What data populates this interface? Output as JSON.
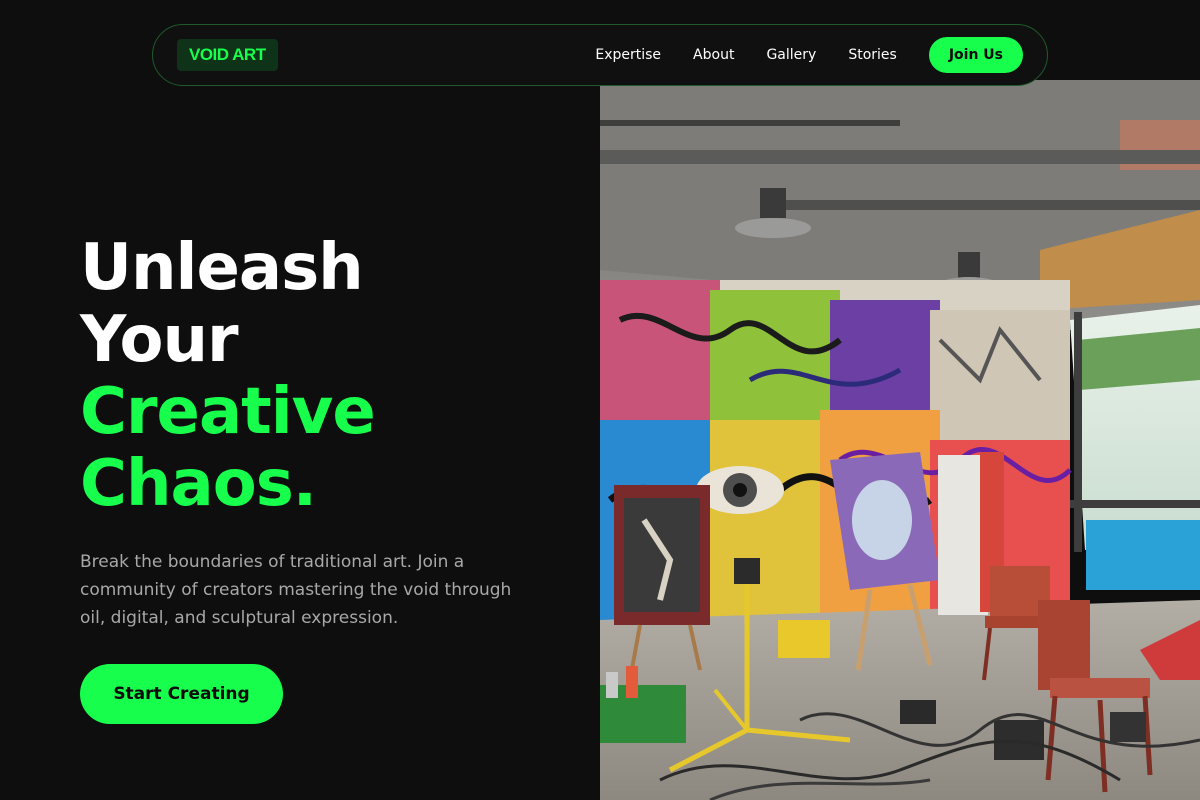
{
  "nav": {
    "logo": "VOID ART",
    "links": [
      "Expertise",
      "About",
      "Gallery",
      "Stories"
    ],
    "cta": "Join Us"
  },
  "hero": {
    "headline_white": [
      "Unleash",
      "Your"
    ],
    "headline_green": [
      "Creative",
      "Chaos."
    ],
    "subtext": "Break the boundaries of traditional art. Join a community of creators mastering the void through oil, digital, and sculptural expression.",
    "cta": "Start Creating",
    "image_alt": "Graffiti-covered art studio with easels, paintings, chairs and a work light"
  },
  "colors": {
    "accent": "#17ff4c",
    "background": "#0e0e0e",
    "logo_bg": "#0f3318",
    "muted_text": "#a8a8a8"
  }
}
